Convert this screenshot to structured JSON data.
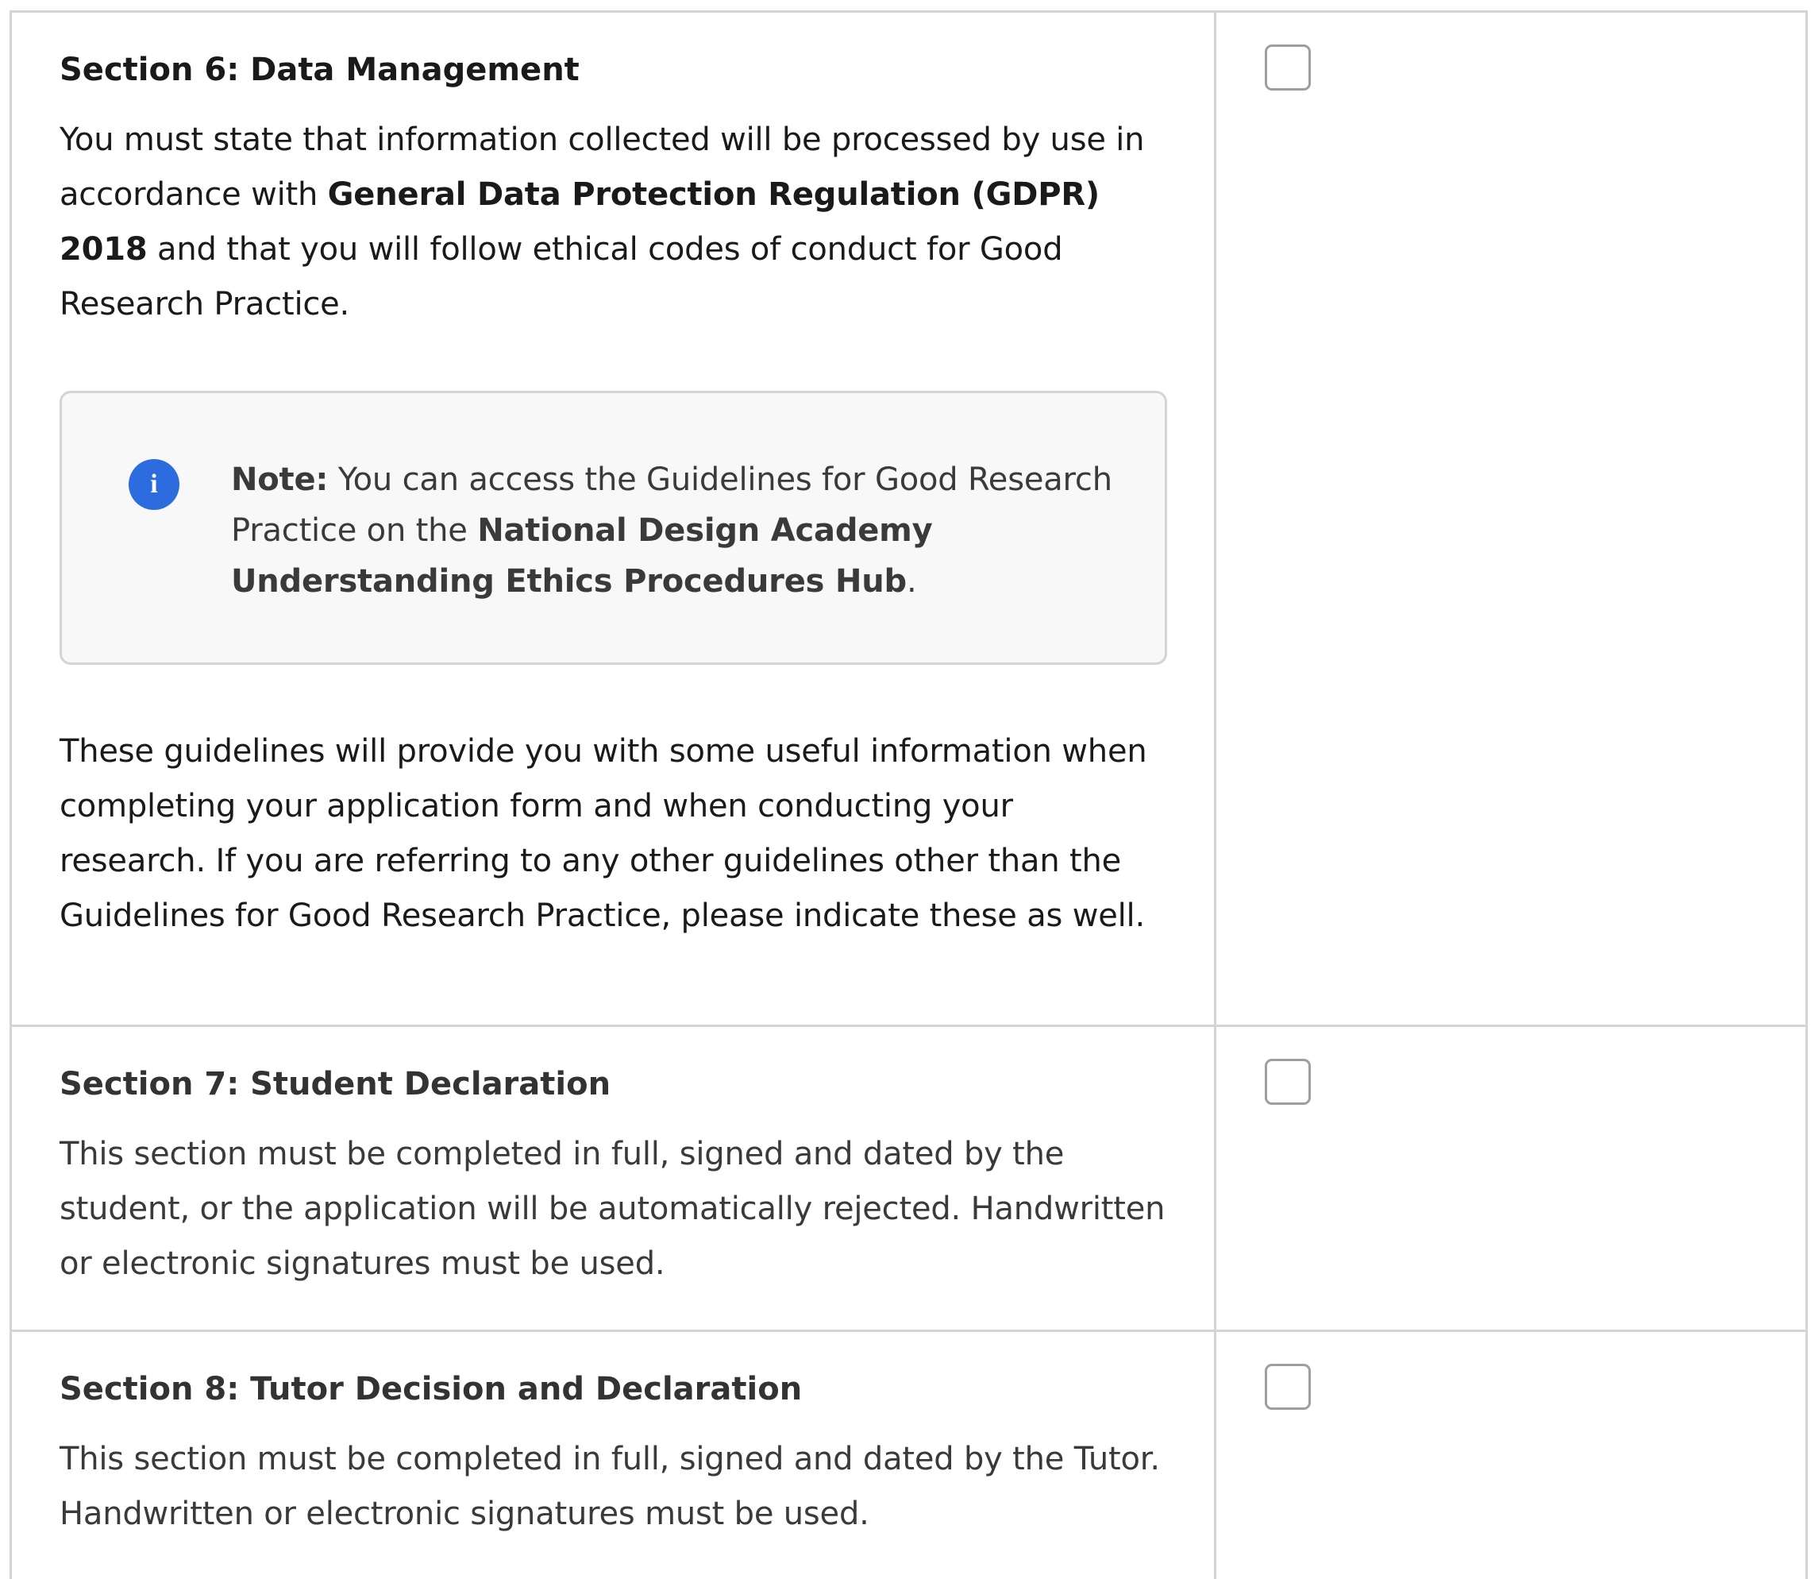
{
  "section6": {
    "title": "Section 6: Data Management",
    "para1_a": "You must state that information collected will be processed by use in accordance with ",
    "para1_b": "General Data Protection Regulation (GDPR) 2018",
    "para1_c": " and that you will follow ethical codes of conduct for Good Research Practice.",
    "note_label": "Note:",
    "note_a": " You can access the Guidelines for Good Research Practice on the ",
    "note_b": "National Design Academy Understanding Ethics Procedures Hub",
    "note_c": ".",
    "note_icon": "info-icon",
    "para2": "These guidelines will provide you with some useful information when completing your application form and when conducting your research. If you are referring to any other guidelines other than the Guidelines for Good Research Practice, please indicate these as well."
  },
  "section7": {
    "title": "Section 7: Student Declaration",
    "para": "This section must be completed in full, signed and dated by the student, or the application will be automatically rejected. Handwritten or electronic signatures must be used."
  },
  "section8": {
    "title": "Section 8: Tutor Decision and Declaration",
    "para": "This section must be completed in full, signed and dated by the Tutor. Handwritten or electronic signatures must be used."
  },
  "colors": {
    "border": "#d4d4d4",
    "info_icon": "#2d6cdf",
    "note_bg": "#f8f8f8"
  }
}
